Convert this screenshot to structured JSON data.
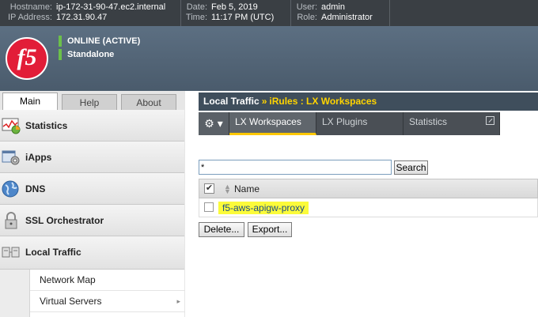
{
  "topbar": {
    "hostname_label": "Hostname:",
    "hostname": "ip-172-31-90-47.ec2.internal",
    "ip_label": "IP Address:",
    "ip": "172.31.90.47",
    "date_label": "Date:",
    "date": "Feb 5, 2019",
    "time_label": "Time:",
    "time": "11:17 PM (UTC)",
    "user_label": "User:",
    "user": "admin",
    "role_label": "Role:",
    "role": "Administrator"
  },
  "header": {
    "logo_text": "f5",
    "status": "ONLINE (ACTIVE)",
    "mode": "Standalone",
    "status_color": "#6cc04a"
  },
  "main_tabs": [
    {
      "label": "Main",
      "active": true
    },
    {
      "label": "Help",
      "active": false
    },
    {
      "label": "About",
      "active": false
    }
  ],
  "sidebar": {
    "items": [
      {
        "label": "Statistics",
        "icon": "statistics-icon"
      },
      {
        "label": "iApps",
        "icon": "iapps-icon"
      },
      {
        "label": "DNS",
        "icon": "dns-globe-icon"
      },
      {
        "label": "SSL Orchestrator",
        "icon": "lock-icon"
      },
      {
        "label": "Local Traffic",
        "icon": "local-traffic-icon"
      }
    ],
    "sub_items": [
      {
        "label": "Network Map",
        "arrow": ""
      },
      {
        "label": "Virtual Servers",
        "arrow": "▸"
      }
    ]
  },
  "breadcrumb": {
    "section": "Local Traffic",
    "separator": "»",
    "current": "iRules : LX Workspaces"
  },
  "subnav": {
    "gear_label": "⚙ ▾",
    "tabs": [
      {
        "label": "LX Workspaces",
        "active": true
      },
      {
        "label": "LX Plugins",
        "active": false
      },
      {
        "label": "Statistics",
        "active": false
      }
    ]
  },
  "search": {
    "value": "*",
    "button": "Search"
  },
  "table": {
    "column_name": "Name",
    "header_check": "✔",
    "rows": [
      {
        "name": "f5-aws-apigw-proxy"
      }
    ]
  },
  "actions": {
    "delete": "Delete...",
    "export": "Export..."
  },
  "colors": {
    "accent": "#ffc800",
    "highlight": "#fbfb3a",
    "brand": "#e21d38"
  }
}
